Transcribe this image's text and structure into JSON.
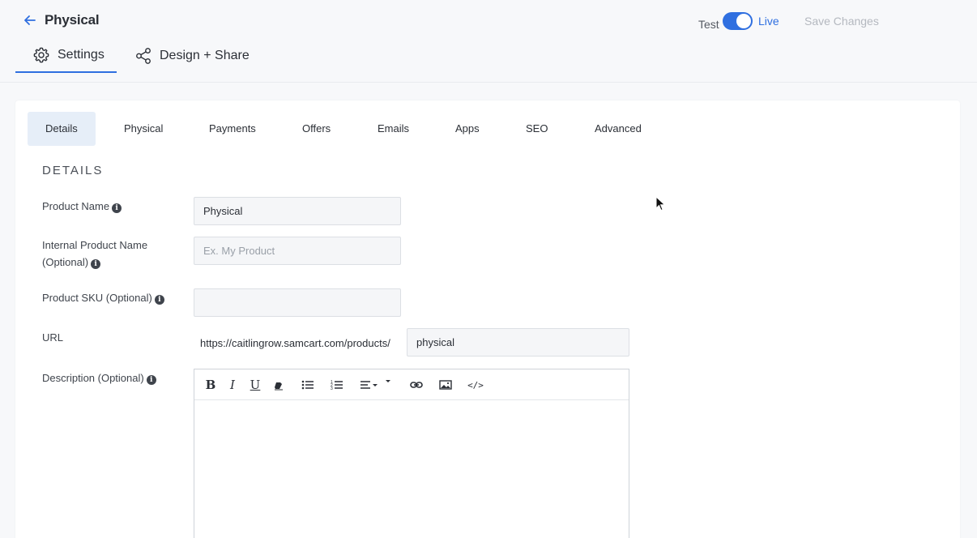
{
  "header": {
    "title": "Physical",
    "mode_test": "Test",
    "mode_live": "Live",
    "live_enabled": true,
    "save_label": "Save Changes"
  },
  "main_tabs": [
    {
      "label": "Settings",
      "icon": "gear-icon",
      "active": true
    },
    {
      "label": "Design + Share",
      "icon": "share-icon",
      "active": false
    }
  ],
  "sub_tabs": [
    {
      "label": "Details",
      "active": true
    },
    {
      "label": "Physical"
    },
    {
      "label": "Payments"
    },
    {
      "label": "Offers"
    },
    {
      "label": "Emails"
    },
    {
      "label": "Apps"
    },
    {
      "label": "SEO"
    },
    {
      "label": "Advanced"
    }
  ],
  "details": {
    "section_title": "DETAILS",
    "product_name": {
      "label": "Product Name",
      "value": "Physical"
    },
    "internal_name": {
      "label_line1": "Internal Product Name",
      "label_line2": "(Optional)",
      "placeholder": "Ex. My Product"
    },
    "sku": {
      "label": "Product SKU (Optional)",
      "value": ""
    },
    "url": {
      "label": "URL",
      "prefix": "https://caitlingrow.samcart.com/products/",
      "slug": "physical"
    },
    "description": {
      "label": "Description (Optional)"
    }
  },
  "editor_toolbar": [
    "bold-icon",
    "italic-icon",
    "underline-icon",
    "eraser-icon",
    "bullet-list-icon",
    "numbered-list-icon",
    "align-icon",
    "link-icon",
    "image-icon",
    "code-icon"
  ],
  "colors": {
    "accent": "#2f6fe0",
    "active_tab_bg": "#e6eef8"
  }
}
